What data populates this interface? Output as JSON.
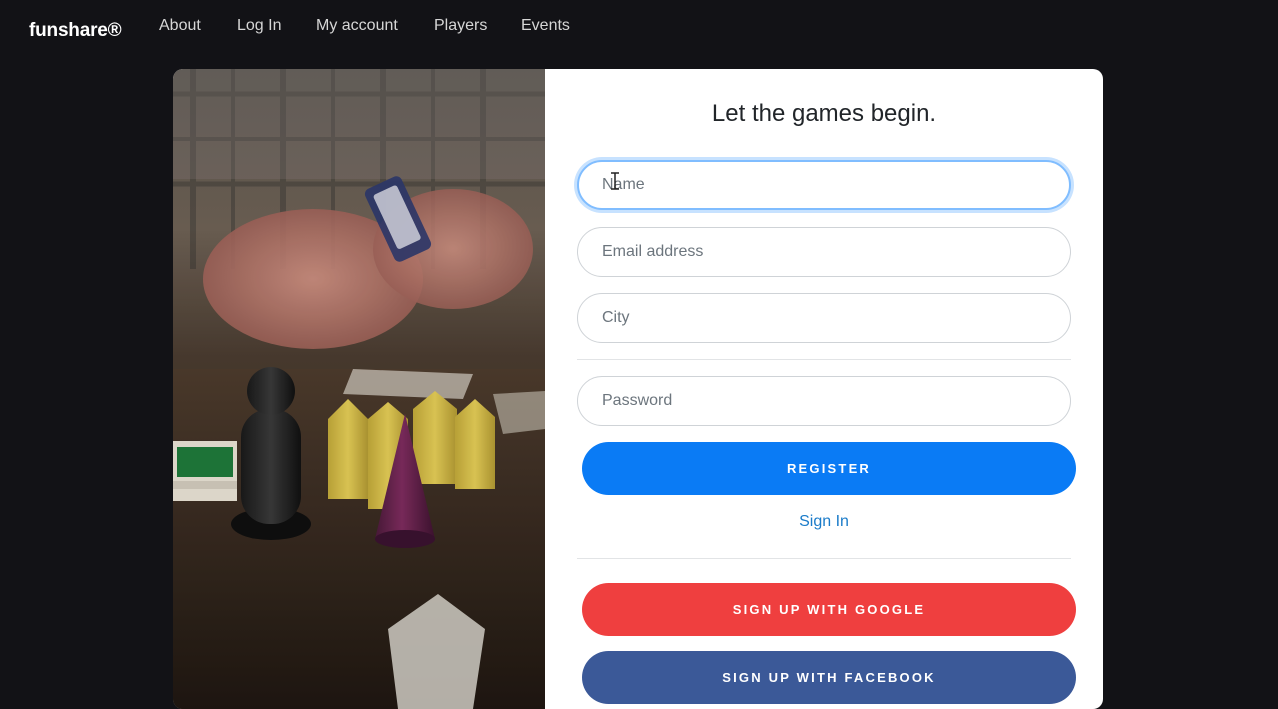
{
  "nav": {
    "brand": "funshare®",
    "links": [
      "About",
      "Log In",
      "My account",
      "Players",
      "Events"
    ]
  },
  "form": {
    "headline": "Let the games begin.",
    "fields": {
      "name_placeholder": "Name",
      "email_placeholder": "Email address",
      "city_placeholder": "City",
      "password_placeholder": "Password"
    },
    "register_label": "REGISTER",
    "signin_label": "Sign In",
    "google_label": "SIGN UP WITH GOOGLE",
    "facebook_label": "SIGN UP WITH FACEBOOK"
  },
  "colors": {
    "background": "#121216",
    "register": "#0a7bf5",
    "google": "#ef3f3f",
    "facebook": "#3b5998",
    "link": "#1a7bc9",
    "focus_ring": "#80bdff"
  }
}
